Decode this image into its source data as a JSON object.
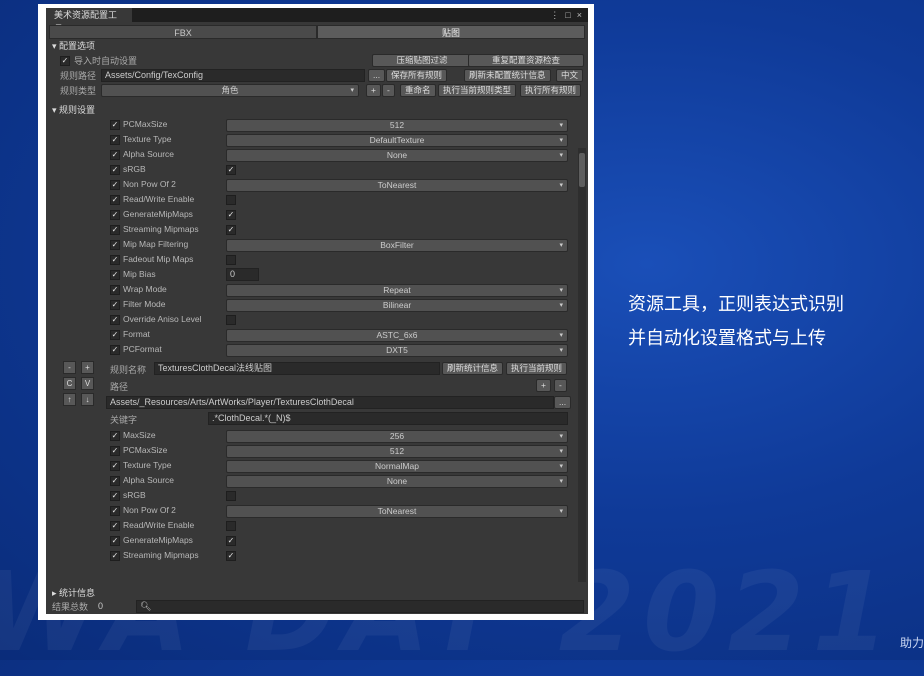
{
  "window": {
    "title": "美术资源配置工具",
    "tabs": [
      "FBX",
      "贴图"
    ]
  },
  "config": {
    "header": "配置选项",
    "auto_import_label": "导入时自动设置",
    "auto_import_checked": true,
    "btn_compress_filter": "压缩贴图过滤",
    "btn_reset_check": "重复配置资源检查",
    "rule_path_label": "规则路径",
    "rule_path_value": "Assets/Config/TexConfig",
    "btn_browse": "...",
    "btn_save_all": "保存所有规则",
    "btn_refresh_stats": "刷新未配置统计信息",
    "btn_lang": "中文",
    "rule_type_label": "规则类型",
    "rule_type_value": "角色",
    "btn_plus": "+",
    "btn_minus": "-",
    "btn_rename": "重命名",
    "btn_exec_type": "执行当前规则类型",
    "btn_exec_all": "执行所有规则"
  },
  "rules": {
    "header": "规则设置",
    "props": [
      {
        "name": "PCMaxSize",
        "type": "dropdown",
        "value": "512"
      },
      {
        "name": "Texture Type",
        "type": "dropdown",
        "value": "DefaultTexture"
      },
      {
        "name": "Alpha Source",
        "type": "dropdown",
        "value": "None"
      },
      {
        "name": "sRGB",
        "type": "check",
        "value": true
      },
      {
        "name": "Non Pow Of 2",
        "type": "dropdown",
        "value": "ToNearest"
      },
      {
        "name": "Read/Write Enable",
        "type": "check",
        "value": false
      },
      {
        "name": "GenerateMipMaps",
        "type": "check",
        "value": true
      },
      {
        "name": "Streaming Mipmaps",
        "type": "check",
        "value": true
      },
      {
        "name": "Mip Map Filtering",
        "type": "dropdown",
        "value": "BoxFilter"
      },
      {
        "name": "Fadeout Mip Maps",
        "type": "check",
        "value": false
      },
      {
        "name": "Mip Bias",
        "type": "number",
        "value": "0"
      },
      {
        "name": "Wrap Mode",
        "type": "dropdown",
        "value": "Repeat"
      },
      {
        "name": "Filter Mode",
        "type": "dropdown",
        "value": "Bilinear"
      },
      {
        "name": "Override Aniso Level",
        "type": "check",
        "value": false
      },
      {
        "name": "Format",
        "type": "dropdown",
        "value": "ASTC_6x6"
      },
      {
        "name": "PCFormat",
        "type": "dropdown",
        "value": "DXT5"
      }
    ],
    "side_buttons": [
      "-",
      "+",
      "C",
      "V",
      "↑",
      "↓"
    ],
    "rule_name_label": "规则名称",
    "rule_name_value": "TexturesClothDecal法线贴图",
    "btn_refresh": "刷新统计信息",
    "btn_exec_rule": "执行当前规则",
    "path_label": "路径",
    "path_value": "Assets/_Resources/Arts/ArtWorks/Player/TexturesClothDecal",
    "path_browse": "...",
    "path_plus": "+",
    "path_minus": "-",
    "keyword_label": "关键字",
    "keyword_value": ".*ClothDecal.*(_N)$",
    "props2": [
      {
        "name": "MaxSize",
        "type": "dropdown",
        "value": "256"
      },
      {
        "name": "PCMaxSize",
        "type": "dropdown",
        "value": "512"
      },
      {
        "name": "Texture Type",
        "type": "dropdown",
        "value": "NormalMap"
      },
      {
        "name": "Alpha Source",
        "type": "dropdown",
        "value": "None"
      },
      {
        "name": "sRGB",
        "type": "check",
        "value": false
      },
      {
        "name": "Non Pow Of 2",
        "type": "dropdown",
        "value": "ToNearest"
      },
      {
        "name": "Read/Write Enable",
        "type": "check",
        "value": false
      },
      {
        "name": "GenerateMipMaps",
        "type": "check",
        "value": true
      },
      {
        "name": "Streaming Mipmaps",
        "type": "check",
        "value": true
      }
    ]
  },
  "stats": {
    "header": "统计信息",
    "result_label": "结果总数",
    "result_value": "0",
    "search_icon": "search-icon"
  },
  "slide": {
    "caption_line1": "资源工具，正则表达式识别",
    "caption_line2": "并自动化设置格式与上传",
    "watermark": "WA DAY 2021",
    "corner": "助力"
  }
}
